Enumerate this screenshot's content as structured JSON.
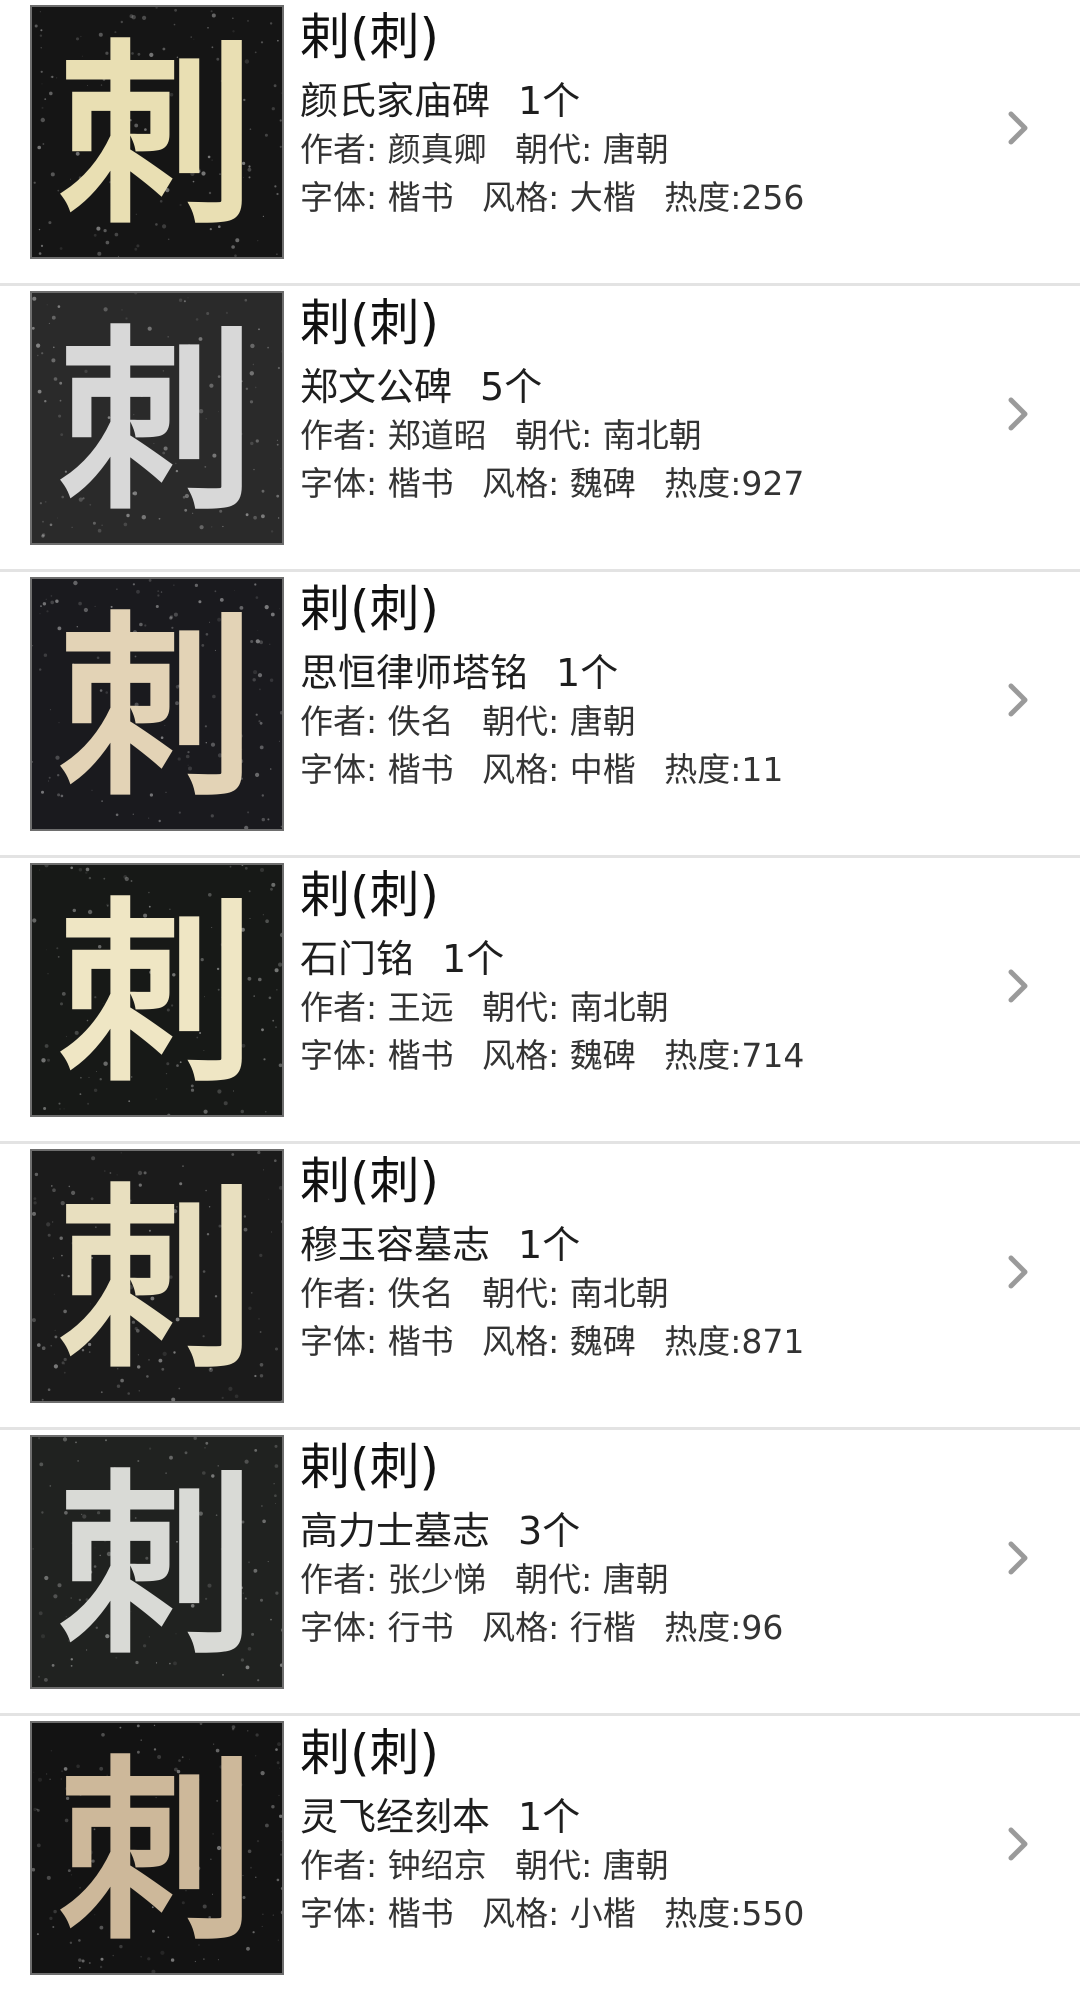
{
  "items": [
    {
      "char": "刺",
      "title": "剌(刺)",
      "work": "颜氏家庙碑",
      "count": "1个",
      "author_label": "作者:",
      "author": "颜真卿",
      "dynasty_label": "朝代:",
      "dynasty": "唐朝",
      "script_label": "字体:",
      "script": "楷书",
      "style_label": "风格:",
      "style": "大楷",
      "heat_label": "热度:",
      "heat": "256",
      "glyph_color": "#e9dfb3",
      "bg_color": "#151515"
    },
    {
      "char": "刺",
      "title": "剌(刺)",
      "work": "郑文公碑",
      "count": "5个",
      "author_label": "作者:",
      "author": "郑道昭",
      "dynasty_label": "朝代:",
      "dynasty": "南北朝",
      "script_label": "字体:",
      "script": "楷书",
      "style_label": "风格:",
      "style": "魏碑",
      "heat_label": "热度:",
      "heat": "927",
      "glyph_color": "#d8d8d8",
      "bg_color": "#2a2a2a"
    },
    {
      "char": "刺",
      "title": "剌(刺)",
      "work": "思恒律师塔铭",
      "count": "1个",
      "author_label": "作者:",
      "author": "佚名",
      "dynasty_label": "朝代:",
      "dynasty": "唐朝",
      "script_label": "字体:",
      "script": "楷书",
      "style_label": "风格:",
      "style": "中楷",
      "heat_label": "热度:",
      "heat": "11",
      "glyph_color": "#e3d3b6",
      "bg_color": "#1a1a1e"
    },
    {
      "char": "刺",
      "title": "剌(刺)",
      "work": "石门铭",
      "count": "1个",
      "author_label": "作者:",
      "author": "王远",
      "dynasty_label": "朝代:",
      "dynasty": "南北朝",
      "script_label": "字体:",
      "script": "楷书",
      "style_label": "风格:",
      "style": "魏碑",
      "heat_label": "热度:",
      "heat": "714",
      "glyph_color": "#efe6c4",
      "bg_color": "#171917"
    },
    {
      "char": "刺",
      "title": "剌(刺)",
      "work": "穆玉容墓志",
      "count": "1个",
      "author_label": "作者:",
      "author": "佚名",
      "dynasty_label": "朝代:",
      "dynasty": "南北朝",
      "script_label": "字体:",
      "script": "楷书",
      "style_label": "风格:",
      "style": "魏碑",
      "heat_label": "热度:",
      "heat": "871",
      "glyph_color": "#e8dfbf",
      "bg_color": "#1b1b1b"
    },
    {
      "char": "刺",
      "title": "剌(刺)",
      "work": "高力士墓志",
      "count": "3个",
      "author_label": "作者:",
      "author": "张少悌",
      "dynasty_label": "朝代:",
      "dynasty": "唐朝",
      "script_label": "字体:",
      "script": "行书",
      "style_label": "风格:",
      "style": "行楷",
      "heat_label": "热度:",
      "heat": "96",
      "glyph_color": "#d9dad6",
      "bg_color": "#202220"
    },
    {
      "char": "刺",
      "title": "剌(刺)",
      "work": "灵飞经刻本",
      "count": "1个",
      "author_label": "作者:",
      "author": "钟绍京",
      "dynasty_label": "朝代:",
      "dynasty": "唐朝",
      "script_label": "字体:",
      "script": "楷书",
      "style_label": "风格:",
      "style": "小楷",
      "heat_label": "热度:",
      "heat": "550",
      "glyph_color": "#cdb89a",
      "bg_color": "#131313"
    }
  ],
  "chevron_icon": "chevron-right-icon",
  "chevron_color": "#9a9a9a",
  "divider_color": "#e3e3e3"
}
